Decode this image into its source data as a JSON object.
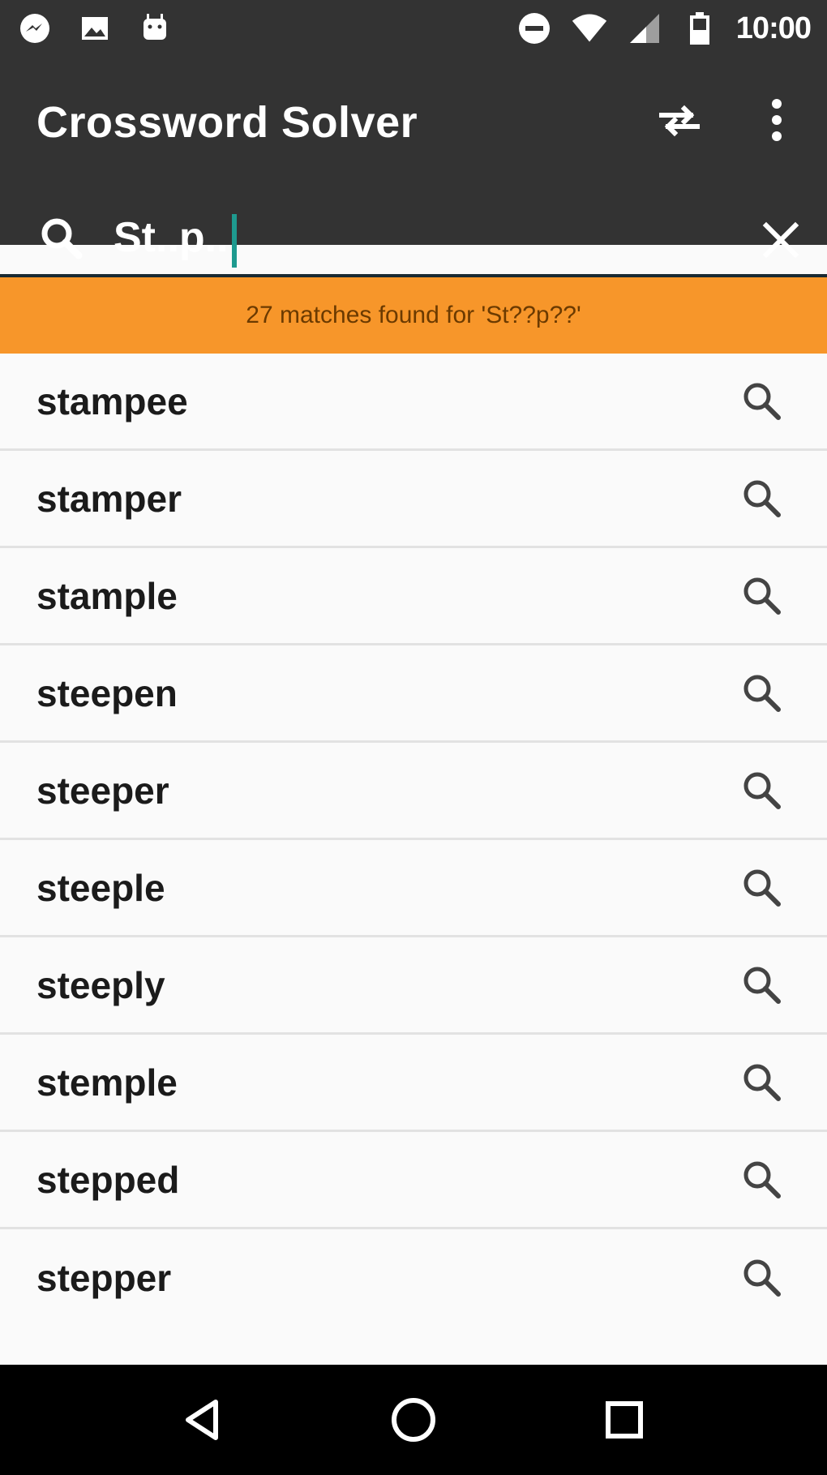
{
  "status_bar": {
    "time": "10:00",
    "left_icons": [
      "messenger-icon",
      "image-icon",
      "android-icon"
    ],
    "right_icons": [
      "do-not-disturb-icon",
      "wifi-icon",
      "cell-signal-icon",
      "battery-icon"
    ]
  },
  "app": {
    "title": "Crossword Solver",
    "actions": [
      "swap-icon",
      "more-vert-icon"
    ]
  },
  "search": {
    "value": "St..p..",
    "clear_icon": "close-icon"
  },
  "banner": {
    "text": "27 matches found for 'St??p??'"
  },
  "results": [
    "stampee",
    "stamper",
    "stample",
    "steepen",
    "steeper",
    "steeple",
    "steeply",
    "stemple",
    "stepped",
    "stepper"
  ],
  "colors": {
    "toolbar": "#333333",
    "accent": "#f7962a",
    "cursor": "#1e9a8f",
    "background": "#fafafa"
  },
  "nav": [
    "back-icon",
    "home-icon",
    "recents-icon"
  ]
}
